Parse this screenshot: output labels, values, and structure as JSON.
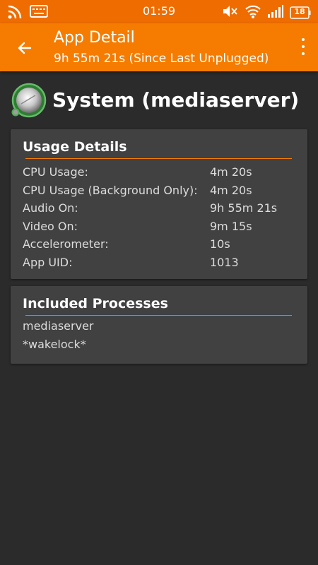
{
  "status_bar": {
    "time": "01:59",
    "battery_level": "18",
    "icons": [
      "rss-icon",
      "keyboard-icon",
      "mute-icon",
      "wifi-icon",
      "signal-icon",
      "battery-icon"
    ]
  },
  "app_bar": {
    "title": "App Detail",
    "subtitle": "9h 55m 21s (Since Last Unplugged)"
  },
  "app": {
    "name": "System (mediaserver)",
    "icon": "power-gauge-icon"
  },
  "usage_details": {
    "title": "Usage Details",
    "rows": [
      {
        "label": "CPU Usage:",
        "value": "4m 20s"
      },
      {
        "label": "CPU Usage (Background Only):",
        "value": "4m 20s"
      },
      {
        "label": "Audio On:",
        "value": "9h 55m 21s"
      },
      {
        "label": "Video On:",
        "value": "9m 15s"
      },
      {
        "label": "Accelerometer:",
        "value": "10s"
      },
      {
        "label": "App UID:",
        "value": "1013"
      }
    ]
  },
  "included_processes": {
    "title": "Included Processes",
    "items": [
      "mediaserver",
      "*wakelock*"
    ]
  },
  "colors": {
    "accent": "#f57c00",
    "background": "#2b2b2b",
    "card": "#414141"
  }
}
